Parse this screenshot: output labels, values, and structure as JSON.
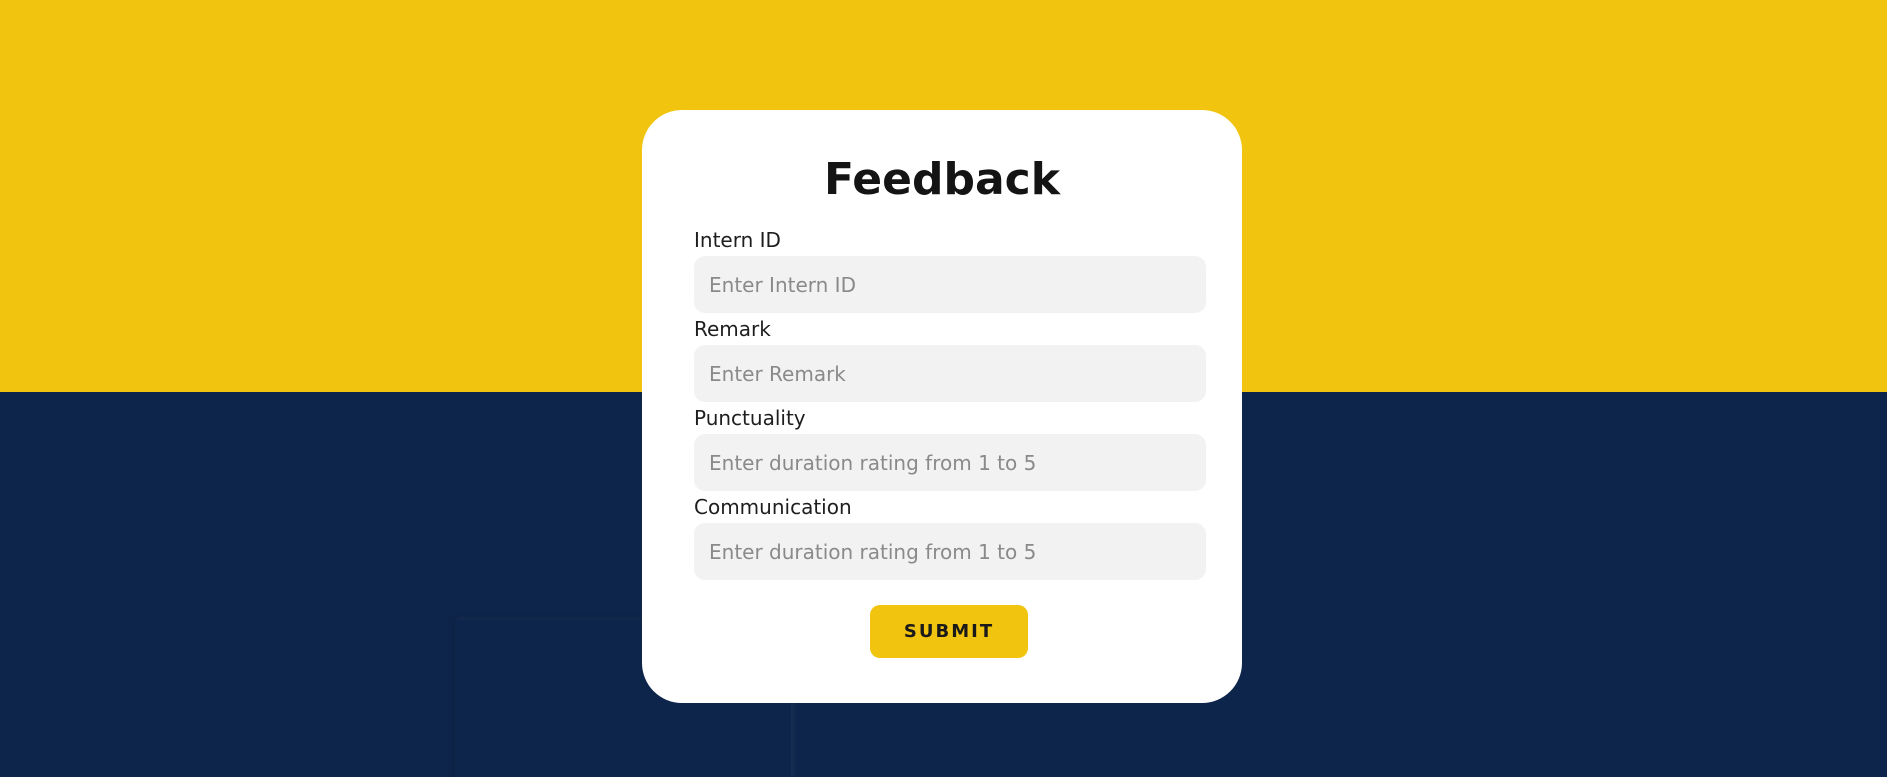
{
  "form": {
    "title": "Feedback",
    "fields": [
      {
        "label": "Intern ID",
        "placeholder": "Enter Intern ID"
      },
      {
        "label": "Remark",
        "placeholder": "Enter Remark"
      },
      {
        "label": "Punctuality",
        "placeholder": "Enter duration rating from 1 to 5"
      },
      {
        "label": "Communication",
        "placeholder": "Enter duration rating from 1 to 5"
      }
    ],
    "submit_label": "SUBMIT"
  },
  "colors": {
    "accent_yellow": "#f1c40f",
    "navy": "#0e254b",
    "card": "#ffffff",
    "input_bg": "#f2f2f2"
  }
}
